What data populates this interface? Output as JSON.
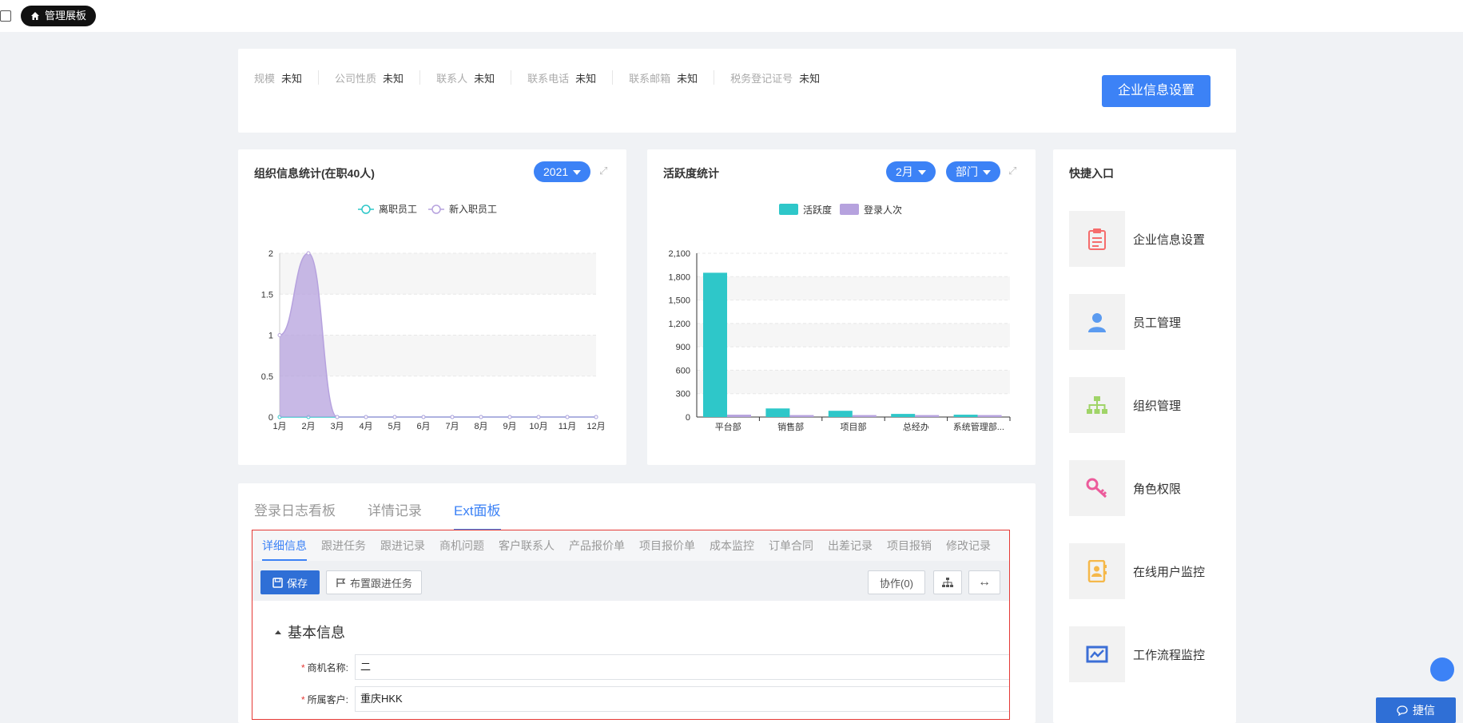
{
  "topbar": {
    "home_label": "管理展板"
  },
  "company": {
    "fields": [
      {
        "label": "规模",
        "value": "未知"
      },
      {
        "label": "公司性质",
        "value": "未知"
      },
      {
        "label": "联系人",
        "value": "未知"
      },
      {
        "label": "联系电话",
        "value": "未知"
      },
      {
        "label": "联系邮箱",
        "value": "未知"
      },
      {
        "label": "税务登记证号",
        "value": "未知"
      }
    ],
    "settings_button": "企业信息设置"
  },
  "org_chart": {
    "title": "组织信息统计(在职40人)",
    "year_selector": "2021"
  },
  "activity_chart": {
    "title": "活跃度统计",
    "month_selector": "2月",
    "group_selector": "部门"
  },
  "chart_data": [
    {
      "type": "area",
      "categories": [
        "1月",
        "2月",
        "3月",
        "4月",
        "5月",
        "6月",
        "7月",
        "8月",
        "9月",
        "10月",
        "11月",
        "12月"
      ],
      "series": [
        {
          "name": "离职员工",
          "values": [
            0,
            0,
            0,
            0,
            0,
            0,
            0,
            0,
            0,
            0,
            0,
            0
          ],
          "color": "#2ec7c9"
        },
        {
          "name": "新入职员工",
          "values": [
            1,
            2,
            0,
            0,
            0,
            0,
            0,
            0,
            0,
            0,
            0,
            0
          ],
          "color": "#b6a2de"
        }
      ],
      "yticks": [
        "0",
        "0.5",
        "1",
        "1.5",
        "2"
      ],
      "ylim": [
        0,
        2
      ],
      "legend": "top-center"
    },
    {
      "type": "bar",
      "categories": [
        "平台部",
        "销售部",
        "项目部",
        "总经办",
        "系统管理部..."
      ],
      "series": [
        {
          "name": "活跃度",
          "values": [
            1850,
            110,
            80,
            40,
            30
          ],
          "color": "#2ec7c9"
        },
        {
          "name": "登录人次",
          "values": [
            30,
            25,
            25,
            25,
            25
          ],
          "color": "#b6a2de"
        }
      ],
      "yticks": [
        "0",
        "300",
        "600",
        "900",
        "1,200",
        "1,500",
        "1,800",
        "2,100"
      ],
      "ylim": [
        0,
        2100
      ],
      "legend": "top-center"
    }
  ],
  "quick": {
    "title": "快捷入口",
    "items": [
      {
        "label": "企业信息设置",
        "icon": "clipboard-icon",
        "color": "#f56c6c"
      },
      {
        "label": "员工管理",
        "icon": "user-icon",
        "color": "#5b9bf0"
      },
      {
        "label": "组织管理",
        "icon": "org-tree-icon",
        "color": "#a0d468"
      },
      {
        "label": "角色权限",
        "icon": "key-icon",
        "color": "#ec5b9b"
      },
      {
        "label": "在线用户监控",
        "icon": "contact-book-icon",
        "color": "#f5b84a"
      },
      {
        "label": "工作流程监控",
        "icon": "monitor-chart-icon",
        "color": "#3c6fd6"
      }
    ]
  },
  "bottom_tabs": [
    "登录日志看板",
    "详情记录",
    "Ext面板"
  ],
  "sub_tabs": [
    "详细信息",
    "跟进任务",
    "跟进记录",
    "商机问题",
    "客户联系人",
    "产品报价单",
    "项目报价单",
    "成本监控",
    "订单合同",
    "出差记录",
    "项目报销",
    "修改记录"
  ],
  "toolbar": {
    "save": "保存",
    "assign": "布置跟进任务",
    "collab": "协作(0)"
  },
  "form": {
    "section": "基本信息",
    "rows": [
      {
        "label": "商机名称:",
        "value": "二"
      },
      {
        "label": "所属客户:",
        "value": "重庆HKK"
      }
    ]
  },
  "jiexin": "捷信"
}
